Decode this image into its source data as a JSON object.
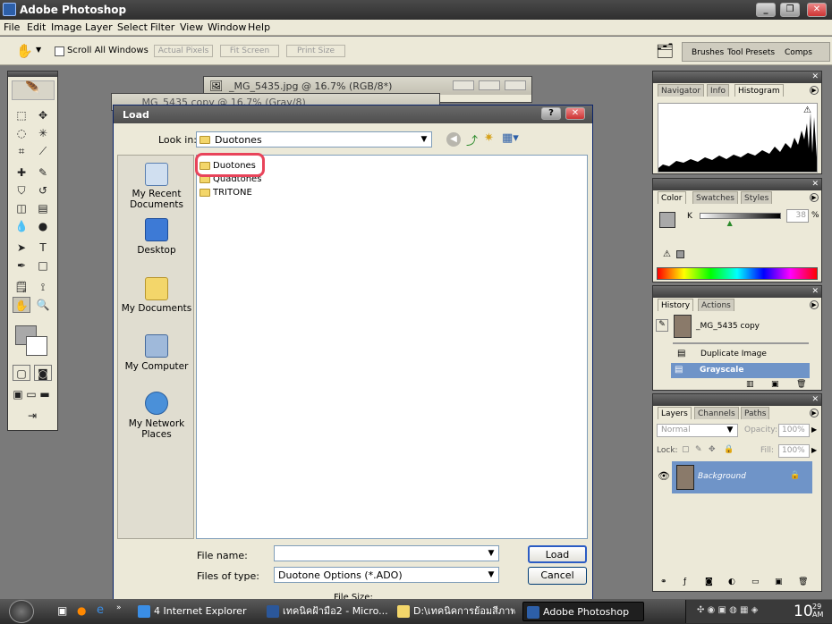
{
  "app": {
    "title": "Adobe Photoshop"
  },
  "menu": [
    "File",
    "Edit",
    "Image",
    "Layer",
    "Select",
    "Filter",
    "View",
    "Window",
    "Help"
  ],
  "options": {
    "scroll_all": "Scroll All Windows",
    "actual_pixels": "Actual Pixels",
    "fit_screen": "Fit Screen",
    "print_size": "Print Size"
  },
  "well_tabs": [
    "Brushes",
    "Tool Presets",
    "Comps"
  ],
  "doc_windows": [
    {
      "title": "_MG_5435.jpg @ 16.7% (RGB/8*)"
    },
    {
      "title": "_MG_5435 copy @ 16.7% (Gray/8)"
    }
  ],
  "dialog": {
    "title": "Load",
    "look_in_label": "Look in:",
    "look_in_value": "Duotones",
    "places": [
      "My Recent Documents",
      "Desktop",
      "My Documents",
      "My Computer",
      "My Network Places"
    ],
    "files": [
      "Duotones",
      "Quadtones",
      "TRITONE"
    ],
    "file_name_label": "File name:",
    "file_name_value": "",
    "files_type_label": "Files of type:",
    "files_type_value": "Duotone Options (*.ADO)",
    "load_button": "Load",
    "cancel_button": "Cancel",
    "file_size_label": "File Size:"
  },
  "panels": {
    "navigator": {
      "tabs": [
        "Navigator",
        "Info",
        "Histogram"
      ],
      "active": "Histogram"
    },
    "color": {
      "tabs": [
        "Color",
        "Swatches",
        "Styles"
      ],
      "channel": "K",
      "value": "38",
      "unit": "%",
      "slider_fraction": 0.38
    },
    "history": {
      "tabs": [
        "History",
        "Actions"
      ],
      "snapshot": "_MG_5435 copy",
      "items": [
        "Duplicate Image",
        "Grayscale"
      ],
      "selected": "Grayscale"
    },
    "layers": {
      "tabs": [
        "Layers",
        "Channels",
        "Paths"
      ],
      "blend_mode": "Normal",
      "opacity_label": "Opacity:",
      "opacity_value": "100%",
      "lock_label": "Lock:",
      "fill_label": "Fill:",
      "fill_value": "100%",
      "layer_name": "Background"
    }
  },
  "taskbar": {
    "items": [
      "4 Internet Explorer",
      "เทคนิคฝ้ามือ2 - Micro...",
      "D:\\เทคนิคการย้อมสีภาพ",
      "Adobe Photoshop"
    ],
    "active": "Adobe Photoshop",
    "clock": "10",
    "clock_small": "29 AM"
  },
  "colors": {
    "highlight": "#e8445a",
    "selection": "#6f94c8",
    "histogram": "#000000"
  }
}
